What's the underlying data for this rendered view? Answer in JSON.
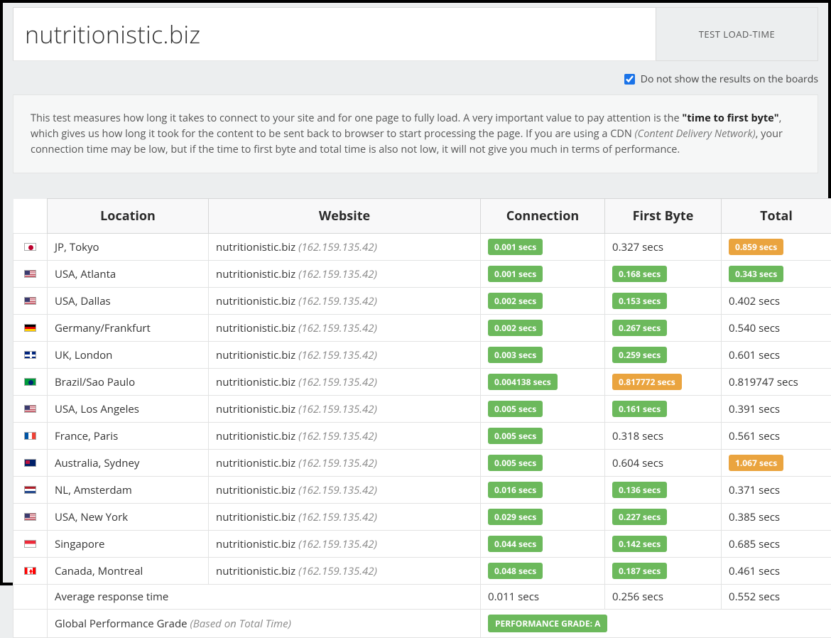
{
  "header": {
    "domain": "nutritionistic.biz",
    "test_button": "TEST LOAD-TIME"
  },
  "option": {
    "label": "Do not show the results on the boards",
    "checked": true
  },
  "description": {
    "p1a": "This test measures how long it takes to connect to your site and for one page to fully load. A very important value to pay attention is the ",
    "p1b": "\"time to first byte\"",
    "p1c": ", which gives us how long it took for the content to be sent back to browser to start processing the page. If you are using a CDN ",
    "p1d": "(Content Delivery Network)",
    "p1e": ", your connection time may be low, but if the time to first byte and total time is also not low, it will not give you much in terms of performance."
  },
  "table": {
    "headers": {
      "location": "Location",
      "website": "Website",
      "connection": "Connection",
      "first_byte": "First Byte",
      "total": "Total"
    },
    "rows": [
      {
        "flag": "jp",
        "location": "JP, Tokyo",
        "site": "nutritionistic.biz",
        "ip": "(162.159.135.42)",
        "conn": {
          "t": "0.001 secs",
          "b": "green"
        },
        "fb": {
          "t": "0.327 secs"
        },
        "tot": {
          "t": "0.859 secs",
          "b": "orange"
        }
      },
      {
        "flag": "us",
        "location": "USA, Atlanta",
        "site": "nutritionistic.biz",
        "ip": "(162.159.135.42)",
        "conn": {
          "t": "0.001 secs",
          "b": "green"
        },
        "fb": {
          "t": "0.168 secs",
          "b": "green"
        },
        "tot": {
          "t": "0.343 secs",
          "b": "green"
        }
      },
      {
        "flag": "us",
        "location": "USA, Dallas",
        "site": "nutritionistic.biz",
        "ip": "(162.159.135.42)",
        "conn": {
          "t": "0.002 secs",
          "b": "green"
        },
        "fb": {
          "t": "0.153 secs",
          "b": "green"
        },
        "tot": {
          "t": "0.402 secs"
        }
      },
      {
        "flag": "de",
        "location": "Germany/Frankfurt",
        "site": "nutritionistic.biz",
        "ip": "(162.159.135.42)",
        "conn": {
          "t": "0.002 secs",
          "b": "green"
        },
        "fb": {
          "t": "0.267 secs",
          "b": "green"
        },
        "tot": {
          "t": "0.540 secs"
        }
      },
      {
        "flag": "gb",
        "location": "UK, London",
        "site": "nutritionistic.biz",
        "ip": "(162.159.135.42)",
        "conn": {
          "t": "0.003 secs",
          "b": "green"
        },
        "fb": {
          "t": "0.259 secs",
          "b": "green"
        },
        "tot": {
          "t": "0.601 secs"
        }
      },
      {
        "flag": "br",
        "location": "Brazil/Sao Paulo",
        "site": "nutritionistic.biz",
        "ip": "(162.159.135.42)",
        "conn": {
          "t": "0.004138 secs",
          "b": "green"
        },
        "fb": {
          "t": "0.817772 secs",
          "b": "orange"
        },
        "tot": {
          "t": "0.819747 secs"
        }
      },
      {
        "flag": "us",
        "location": "USA, Los Angeles",
        "site": "nutritionistic.biz",
        "ip": "(162.159.135.42)",
        "conn": {
          "t": "0.005 secs",
          "b": "green"
        },
        "fb": {
          "t": "0.161 secs",
          "b": "green"
        },
        "tot": {
          "t": "0.391 secs"
        }
      },
      {
        "flag": "fr",
        "location": "France, Paris",
        "site": "nutritionistic.biz",
        "ip": "(162.159.135.42)",
        "conn": {
          "t": "0.005 secs",
          "b": "green"
        },
        "fb": {
          "t": "0.318 secs"
        },
        "tot": {
          "t": "0.561 secs"
        }
      },
      {
        "flag": "au",
        "location": "Australia, Sydney",
        "site": "nutritionistic.biz",
        "ip": "(162.159.135.42)",
        "conn": {
          "t": "0.005 secs",
          "b": "green"
        },
        "fb": {
          "t": "0.604 secs"
        },
        "tot": {
          "t": "1.067 secs",
          "b": "orange"
        }
      },
      {
        "flag": "nl",
        "location": "NL, Amsterdam",
        "site": "nutritionistic.biz",
        "ip": "(162.159.135.42)",
        "conn": {
          "t": "0.016 secs",
          "b": "green"
        },
        "fb": {
          "t": "0.136 secs",
          "b": "green"
        },
        "tot": {
          "t": "0.371 secs"
        }
      },
      {
        "flag": "us",
        "location": "USA, New York",
        "site": "nutritionistic.biz",
        "ip": "(162.159.135.42)",
        "conn": {
          "t": "0.029 secs",
          "b": "green"
        },
        "fb": {
          "t": "0.227 secs",
          "b": "green"
        },
        "tot": {
          "t": "0.385 secs"
        }
      },
      {
        "flag": "sg",
        "location": "Singapore",
        "site": "nutritionistic.biz",
        "ip": "(162.159.135.42)",
        "conn": {
          "t": "0.044 secs",
          "b": "green"
        },
        "fb": {
          "t": "0.142 secs",
          "b": "green"
        },
        "tot": {
          "t": "0.685 secs"
        }
      },
      {
        "flag": "ca",
        "location": "Canada, Montreal",
        "site": "nutritionistic.biz",
        "ip": "(162.159.135.42)",
        "conn": {
          "t": "0.048 secs",
          "b": "green"
        },
        "fb": {
          "t": "0.187 secs",
          "b": "green"
        },
        "tot": {
          "t": "0.461 secs"
        }
      }
    ],
    "avg": {
      "label": "Average response time",
      "conn": "0.011 secs",
      "fb": "0.256 secs",
      "tot": "0.552 secs"
    },
    "grade": {
      "label": "Global Performance Grade ",
      "sub": "(Based on Total Time)",
      "badge": "PERFORMANCE GRADE:  A"
    }
  }
}
